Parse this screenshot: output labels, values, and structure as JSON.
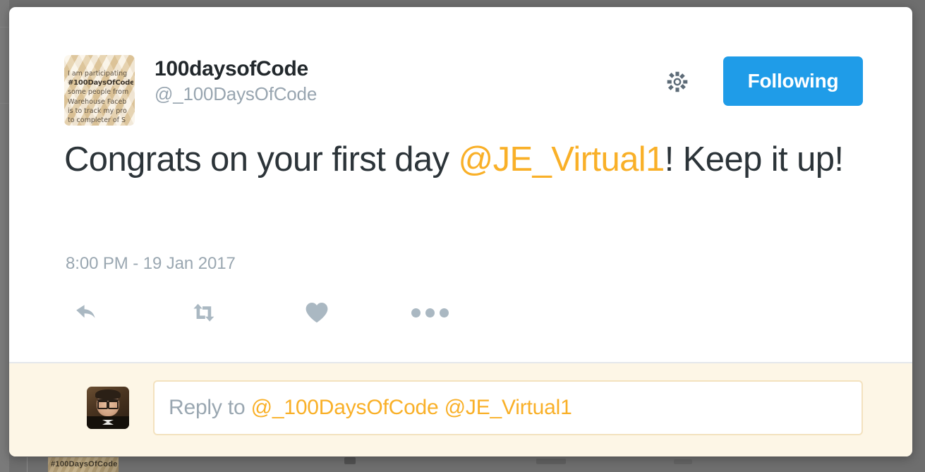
{
  "backdrop": {
    "overlay_color": "#6e6e6e",
    "behind_tile_text": "#100DaysOfCode"
  },
  "tweet": {
    "author": {
      "display_name": "100daysofCode",
      "screen_name": "@_100DaysOfCode",
      "avatar_alt": "100DaysOfCode pledge card",
      "avatar_lines": [
        "I am participating",
        "#100DaysOfCode",
        "some people from",
        "Warehouse Faceb",
        "is to track my pro",
        "to completer of S"
      ]
    },
    "header_actions": {
      "gear_icon": "gear-icon",
      "follow_label": "Following",
      "follow_color": "#1f9ce8"
    },
    "text": {
      "before_mention": "Congrats on your first day ",
      "mention": "@JE_Virtual1",
      "after_mention": "! Keep it up!",
      "mention_color": "#f9b028"
    },
    "timestamp": "8:00 PM - 19 Jan 2017",
    "actions": [
      {
        "name": "reply-icon",
        "label": "Reply"
      },
      {
        "name": "retweet-icon",
        "label": "Retweet"
      },
      {
        "name": "like-icon",
        "label": "Like"
      },
      {
        "name": "more-icon",
        "label": "More"
      }
    ],
    "action_icon_color": "#aab8c2"
  },
  "reply_composer": {
    "avatar_alt": "Replying user avatar",
    "placeholder_prefix": "Reply to ",
    "placeholder_mentions": "@_100DaysOfCode @JE_Virtual1",
    "background": "#fdf6e6"
  }
}
